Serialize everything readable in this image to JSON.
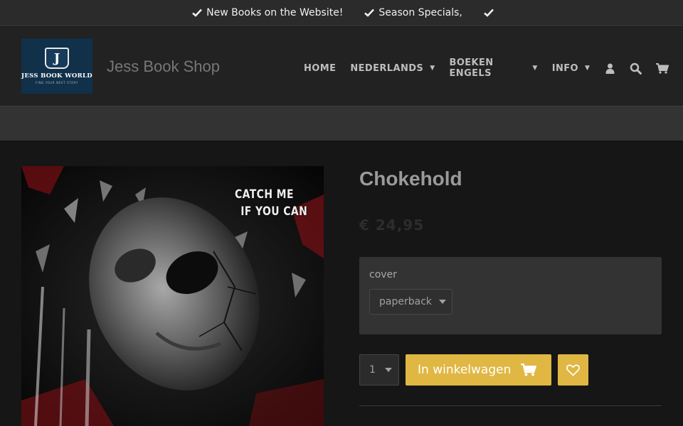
{
  "announcements": [
    {
      "text": "New Books on the Website!",
      "icon": "check-icon"
    },
    {
      "text": "Season Specials,",
      "icon": "check-icon"
    },
    {
      "text": "",
      "icon": "check-icon"
    }
  ],
  "logo": {
    "letter": "J",
    "name": "JESS BOOK WORLD",
    "tagline": "FIND YOUR NEXT STORY"
  },
  "shop_title": "Jess Book Shop",
  "nav": {
    "items": [
      {
        "label": "HOME",
        "has_dropdown": false
      },
      {
        "label": "NEDERLANDS",
        "has_dropdown": true
      },
      {
        "label": "BOEKEN ENGELS",
        "has_dropdown": true
      },
      {
        "label": "INFO",
        "has_dropdown": true
      }
    ],
    "caret": "▼",
    "icons": [
      "user-icon",
      "search-icon",
      "cart-icon"
    ]
  },
  "product": {
    "title": "Chokehold",
    "price": "€ 24,95",
    "cover_text_line1": "CATCH ME",
    "cover_text_line2": "IF YOU CAN",
    "option": {
      "label": "cover",
      "selected": "paperback"
    },
    "quantity": "1",
    "add_to_cart_label": "In winkelwagen"
  },
  "colors": {
    "accent": "#e0b743",
    "background": "#161616",
    "header": "#222222",
    "topbar": "#2b2b2b"
  }
}
